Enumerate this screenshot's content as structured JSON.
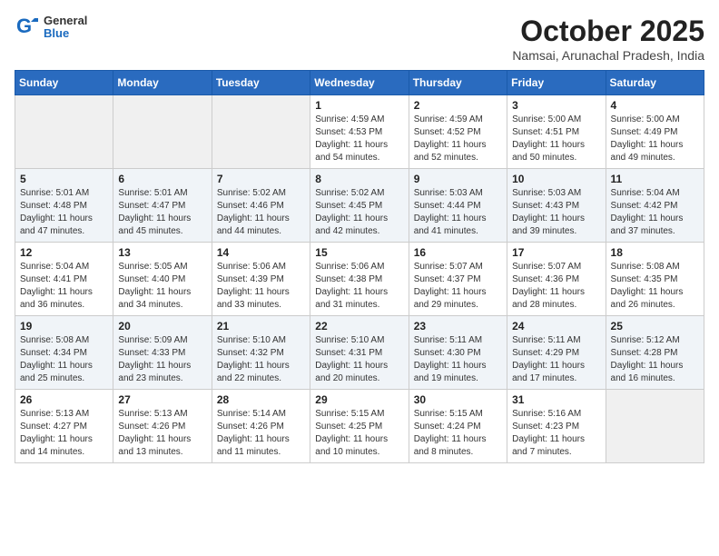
{
  "logo": {
    "general": "General",
    "blue": "Blue"
  },
  "title": "October 2025",
  "subtitle": "Namsai, Arunachal Pradesh, India",
  "weekdays": [
    "Sunday",
    "Monday",
    "Tuesday",
    "Wednesday",
    "Thursday",
    "Friday",
    "Saturday"
  ],
  "weeks": [
    [
      {
        "day": "",
        "info": ""
      },
      {
        "day": "",
        "info": ""
      },
      {
        "day": "",
        "info": ""
      },
      {
        "day": "1",
        "info": "Sunrise: 4:59 AM\nSunset: 4:53 PM\nDaylight: 11 hours\nand 54 minutes."
      },
      {
        "day": "2",
        "info": "Sunrise: 4:59 AM\nSunset: 4:52 PM\nDaylight: 11 hours\nand 52 minutes."
      },
      {
        "day": "3",
        "info": "Sunrise: 5:00 AM\nSunset: 4:51 PM\nDaylight: 11 hours\nand 50 minutes."
      },
      {
        "day": "4",
        "info": "Sunrise: 5:00 AM\nSunset: 4:49 PM\nDaylight: 11 hours\nand 49 minutes."
      }
    ],
    [
      {
        "day": "5",
        "info": "Sunrise: 5:01 AM\nSunset: 4:48 PM\nDaylight: 11 hours\nand 47 minutes."
      },
      {
        "day": "6",
        "info": "Sunrise: 5:01 AM\nSunset: 4:47 PM\nDaylight: 11 hours\nand 45 minutes."
      },
      {
        "day": "7",
        "info": "Sunrise: 5:02 AM\nSunset: 4:46 PM\nDaylight: 11 hours\nand 44 minutes."
      },
      {
        "day": "8",
        "info": "Sunrise: 5:02 AM\nSunset: 4:45 PM\nDaylight: 11 hours\nand 42 minutes."
      },
      {
        "day": "9",
        "info": "Sunrise: 5:03 AM\nSunset: 4:44 PM\nDaylight: 11 hours\nand 41 minutes."
      },
      {
        "day": "10",
        "info": "Sunrise: 5:03 AM\nSunset: 4:43 PM\nDaylight: 11 hours\nand 39 minutes."
      },
      {
        "day": "11",
        "info": "Sunrise: 5:04 AM\nSunset: 4:42 PM\nDaylight: 11 hours\nand 37 minutes."
      }
    ],
    [
      {
        "day": "12",
        "info": "Sunrise: 5:04 AM\nSunset: 4:41 PM\nDaylight: 11 hours\nand 36 minutes."
      },
      {
        "day": "13",
        "info": "Sunrise: 5:05 AM\nSunset: 4:40 PM\nDaylight: 11 hours\nand 34 minutes."
      },
      {
        "day": "14",
        "info": "Sunrise: 5:06 AM\nSunset: 4:39 PM\nDaylight: 11 hours\nand 33 minutes."
      },
      {
        "day": "15",
        "info": "Sunrise: 5:06 AM\nSunset: 4:38 PM\nDaylight: 11 hours\nand 31 minutes."
      },
      {
        "day": "16",
        "info": "Sunrise: 5:07 AM\nSunset: 4:37 PM\nDaylight: 11 hours\nand 29 minutes."
      },
      {
        "day": "17",
        "info": "Sunrise: 5:07 AM\nSunset: 4:36 PM\nDaylight: 11 hours\nand 28 minutes."
      },
      {
        "day": "18",
        "info": "Sunrise: 5:08 AM\nSunset: 4:35 PM\nDaylight: 11 hours\nand 26 minutes."
      }
    ],
    [
      {
        "day": "19",
        "info": "Sunrise: 5:08 AM\nSunset: 4:34 PM\nDaylight: 11 hours\nand 25 minutes."
      },
      {
        "day": "20",
        "info": "Sunrise: 5:09 AM\nSunset: 4:33 PM\nDaylight: 11 hours\nand 23 minutes."
      },
      {
        "day": "21",
        "info": "Sunrise: 5:10 AM\nSunset: 4:32 PM\nDaylight: 11 hours\nand 22 minutes."
      },
      {
        "day": "22",
        "info": "Sunrise: 5:10 AM\nSunset: 4:31 PM\nDaylight: 11 hours\nand 20 minutes."
      },
      {
        "day": "23",
        "info": "Sunrise: 5:11 AM\nSunset: 4:30 PM\nDaylight: 11 hours\nand 19 minutes."
      },
      {
        "day": "24",
        "info": "Sunrise: 5:11 AM\nSunset: 4:29 PM\nDaylight: 11 hours\nand 17 minutes."
      },
      {
        "day": "25",
        "info": "Sunrise: 5:12 AM\nSunset: 4:28 PM\nDaylight: 11 hours\nand 16 minutes."
      }
    ],
    [
      {
        "day": "26",
        "info": "Sunrise: 5:13 AM\nSunset: 4:27 PM\nDaylight: 11 hours\nand 14 minutes."
      },
      {
        "day": "27",
        "info": "Sunrise: 5:13 AM\nSunset: 4:26 PM\nDaylight: 11 hours\nand 13 minutes."
      },
      {
        "day": "28",
        "info": "Sunrise: 5:14 AM\nSunset: 4:26 PM\nDaylight: 11 hours\nand 11 minutes."
      },
      {
        "day": "29",
        "info": "Sunrise: 5:15 AM\nSunset: 4:25 PM\nDaylight: 11 hours\nand 10 minutes."
      },
      {
        "day": "30",
        "info": "Sunrise: 5:15 AM\nSunset: 4:24 PM\nDaylight: 11 hours\nand 8 minutes."
      },
      {
        "day": "31",
        "info": "Sunrise: 5:16 AM\nSunset: 4:23 PM\nDaylight: 11 hours\nand 7 minutes."
      },
      {
        "day": "",
        "info": ""
      }
    ]
  ]
}
